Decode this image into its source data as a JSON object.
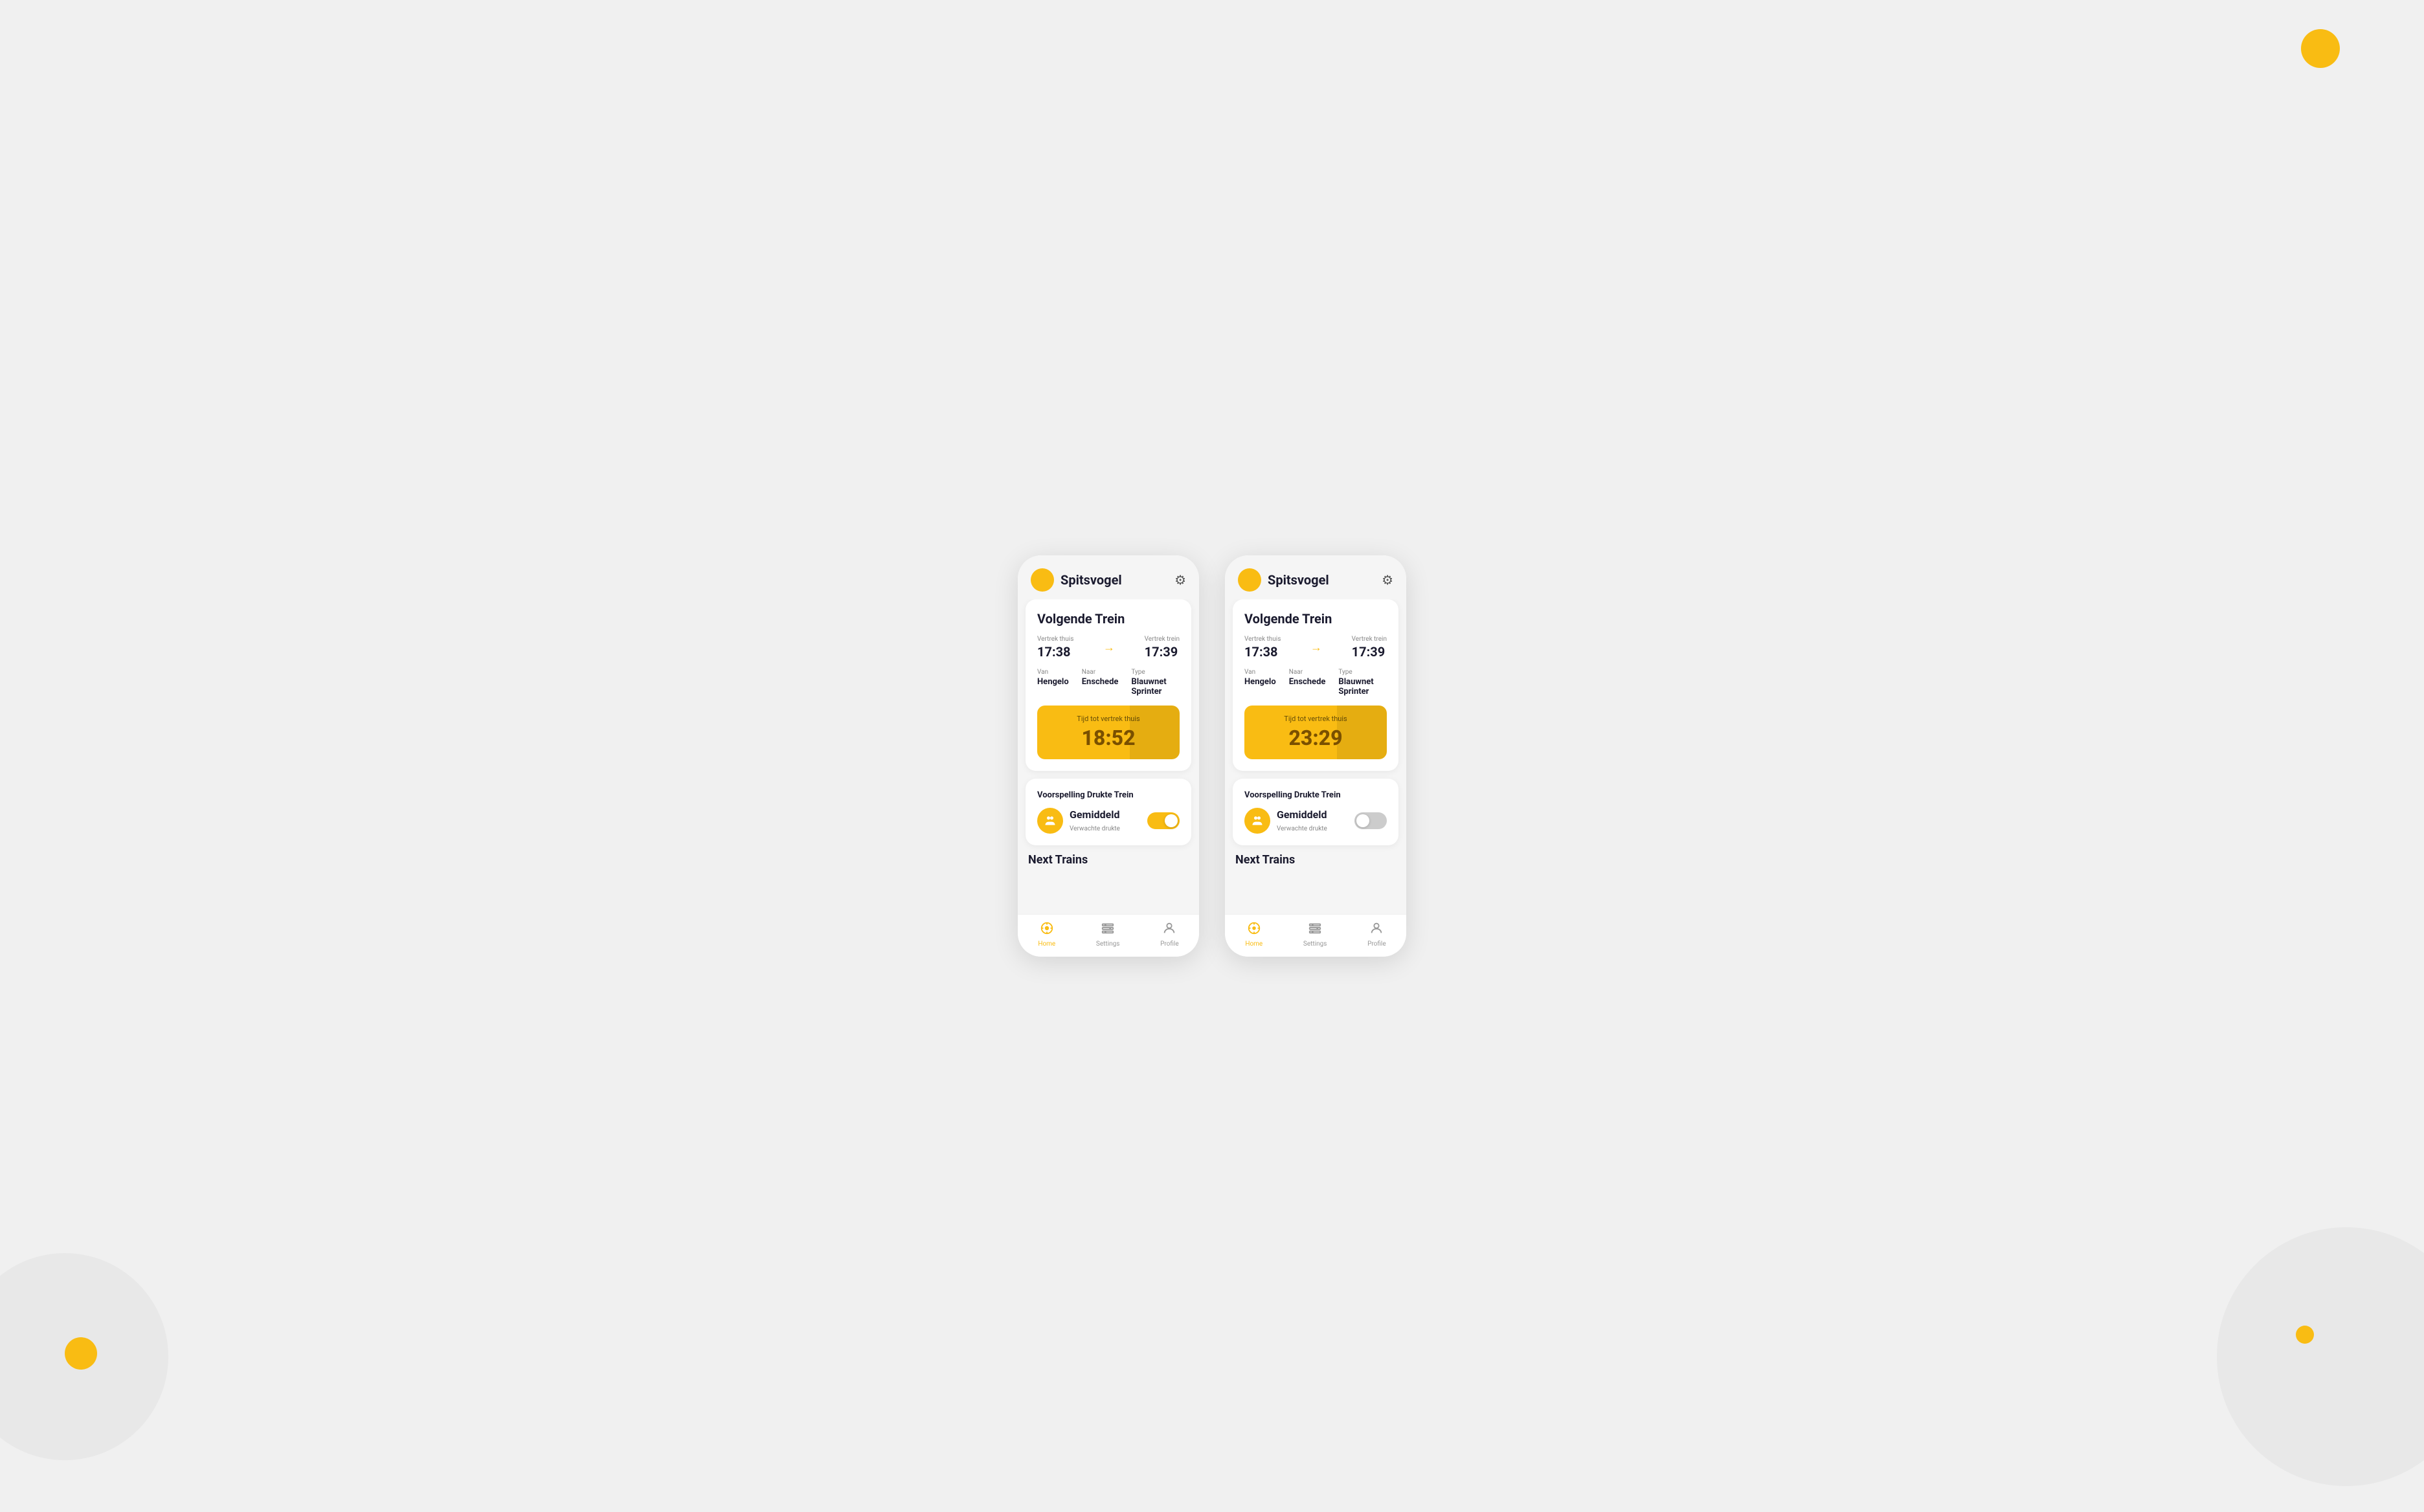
{
  "app": {
    "title": "Spitsvogel",
    "gear_icon": "⚙",
    "background_color": "#f0f0f0"
  },
  "phones": [
    {
      "id": "phone-left",
      "header": {
        "title": "Spitsvogel",
        "settings_icon": "⚙"
      },
      "volgende_trein": {
        "card_title": "Volgende Trein",
        "vertrek_thuis_label": "Vertrek thuis",
        "vertrek_thuis_value": "17:38",
        "arrow": "→",
        "vertrek_trein_label": "Vertrek trein",
        "vertrek_trein_value": "17:39",
        "van_label": "Van",
        "van_value": "Hengelo",
        "naar_label": "Naar",
        "naar_value": "Enschede",
        "type_label": "Type",
        "type_value": "Blauwnet Sprinter",
        "countdown_label": "Tijd tot vertrek thuis",
        "countdown_value": "18:52"
      },
      "drukte": {
        "section_title": "Voorspelling Drukte Trein",
        "level": "Gemiddeld",
        "sublabel": "Verwachte drukte",
        "toggle_on": true
      },
      "next_trains": {
        "title": "Next Trains"
      },
      "nav": {
        "items": [
          {
            "icon": "🕐",
            "label": "Home",
            "active": true
          },
          {
            "icon": "🎫",
            "label": "Settings",
            "active": false
          },
          {
            "icon": "👤",
            "label": "Profile",
            "active": false
          }
        ]
      }
    },
    {
      "id": "phone-right",
      "header": {
        "title": "Spitsvogel",
        "settings_icon": "⚙"
      },
      "volgende_trein": {
        "card_title": "Volgende Trein",
        "vertrek_thuis_label": "Vertrek thuis",
        "vertrek_thuis_value": "17:38",
        "arrow": "→",
        "vertrek_trein_label": "Vertrek trein",
        "vertrek_trein_value": "17:39",
        "van_label": "Van",
        "van_value": "Hengelo",
        "naar_label": "Naar",
        "naar_value": "Enschede",
        "type_label": "Type",
        "type_value": "Blauwnet Sprinter",
        "countdown_label": "Tijd tot vertrek thuis",
        "countdown_value": "23:29"
      },
      "drukte": {
        "section_title": "Voorspelling Drukte Trein",
        "level": "Gemiddeld",
        "sublabel": "Verwachte drukte",
        "toggle_on": false
      },
      "next_trains": {
        "title": "Next Trains"
      },
      "nav": {
        "items": [
          {
            "icon": "🕐",
            "label": "Home",
            "active": true
          },
          {
            "icon": "🎫",
            "label": "Settings",
            "active": false
          },
          {
            "icon": "👤",
            "label": "Profile",
            "active": false
          }
        ]
      }
    }
  ]
}
